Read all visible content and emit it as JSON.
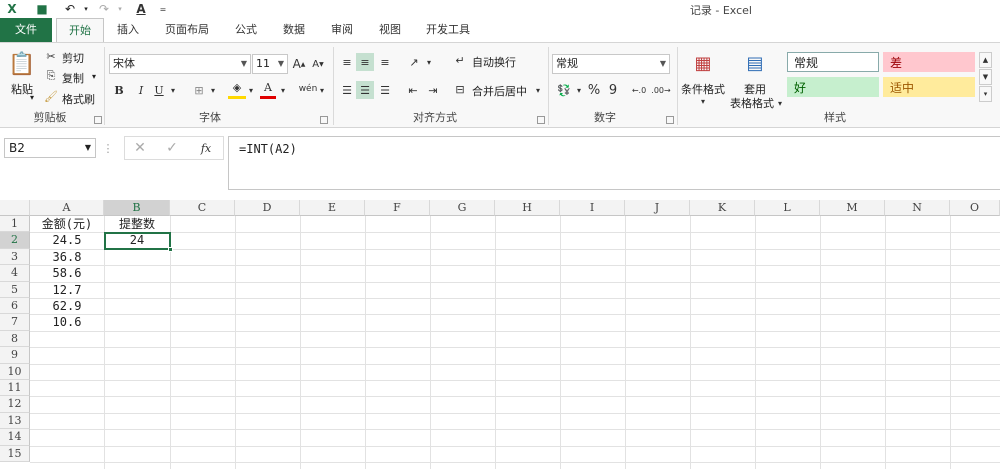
{
  "window": {
    "title": "记录 - Excel"
  },
  "tabs": [
    "文件",
    "开始",
    "插入",
    "页面布局",
    "公式",
    "数据",
    "审阅",
    "视图",
    "开发工具"
  ],
  "ribbon": {
    "clipboard": {
      "paste": "粘贴",
      "cut": "剪切",
      "copy": "复制",
      "format_painter": "格式刷",
      "label": "剪贴板"
    },
    "font": {
      "name": "宋体",
      "size": "11",
      "bold": "B",
      "italic": "I",
      "underline": "U",
      "label": "字体"
    },
    "alignment": {
      "wrap": "自动换行",
      "merge": "合并后居中",
      "label": "对齐方式"
    },
    "number": {
      "format": "常规",
      "percent": "%",
      "comma": "9",
      "label": "数字"
    },
    "styles": {
      "conditional": "条件格式",
      "table_1": "套用",
      "table_2": "表格格式",
      "normal": "常规",
      "bad": "差",
      "good": "好",
      "neutral": "适中",
      "label": "样式"
    }
  },
  "formula_bar": {
    "name_box": "B2",
    "formula": "=INT(A2)",
    "fx": "fx"
  },
  "sheet": {
    "columns": [
      "A",
      "B",
      "C",
      "D",
      "E",
      "F",
      "G",
      "H",
      "I",
      "J",
      "K",
      "L",
      "M",
      "N",
      "O"
    ],
    "rows": [
      "1",
      "2",
      "3",
      "4",
      "5",
      "6",
      "7",
      "8",
      "9",
      "10",
      "11",
      "12",
      "13",
      "14",
      "15"
    ],
    "cells": {
      "A": [
        "金额(元)",
        "24.5",
        "36.8",
        "58.6",
        "12.7",
        "62.9",
        "10.6"
      ],
      "B": [
        "提整数",
        "24"
      ]
    }
  },
  "colors": {
    "accent": "#217346",
    "style_bad_bg": "#ffc7ce",
    "style_good_bg": "#c6efce",
    "style_neutral_bg": "#ffeb9c"
  }
}
